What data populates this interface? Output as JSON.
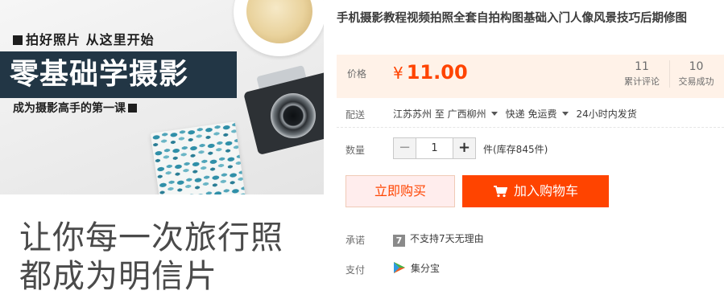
{
  "hero": {
    "tag_top": "拍好照片  从这里开始",
    "banner": "零基础学摄影",
    "tag_bottom": "成为摄影高手的第一课",
    "slogan_line1": "让你每一次旅行照",
    "slogan_line2": "都成为明信片"
  },
  "product": {
    "title": "手机摄影教程视频拍照全套自拍构图基础入门人像风景技巧后期修图"
  },
  "price": {
    "label": "价格",
    "currency": "¥",
    "amount": "11.00",
    "reviews_count": "11",
    "reviews_label": "累计评论",
    "sales_count": "10",
    "sales_label": "交易成功"
  },
  "shipping": {
    "label": "配送",
    "from": "江苏苏州 至",
    "to": "广西柳州",
    "method": "快递 免运费",
    "dispatch": "24小时内发货"
  },
  "quantity": {
    "label": "数量",
    "minus": "−",
    "value": "1",
    "plus": "+",
    "stock": "件(库存845件)"
  },
  "actions": {
    "buy_now": "立即购买",
    "add_to_cart": "加入购物车"
  },
  "promise": {
    "label": "承诺",
    "badge": "7",
    "text": "不支持7天无理由"
  },
  "payment": {
    "label": "支付",
    "method": "集分宝"
  },
  "colors": {
    "accent": "#ff4400",
    "price_bg": "#fff2e8",
    "buy_now_bg": "#ffeded",
    "banner_bg": "#223645"
  }
}
